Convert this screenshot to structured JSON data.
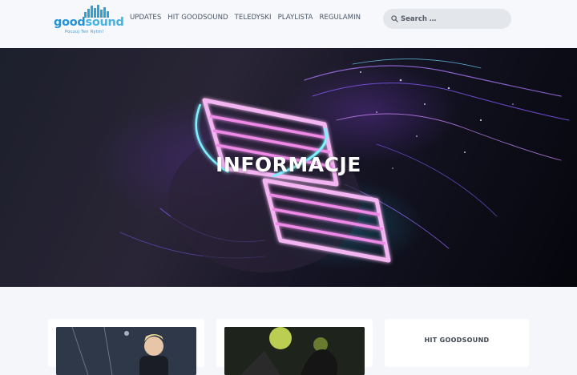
{
  "brand": {
    "name_part1": "good",
    "name_part2": "sound",
    "tagline": "Poczuj Ten Rytm!",
    "primary_color": "#1f95d8",
    "secondary_color": "#41b3e4"
  },
  "nav": {
    "items": [
      {
        "label": "UPDATES"
      },
      {
        "label": "HIT GOODSOUND"
      },
      {
        "label": "TELEDYSKI"
      },
      {
        "label": "PLAYLISTA"
      },
      {
        "label": "REGULAMIN"
      }
    ]
  },
  "search": {
    "placeholder": "Search …",
    "icon": "search-icon"
  },
  "hero": {
    "title": "INFORMACJE"
  },
  "sidebar": {
    "widget_title": "HIT GOODSOUND"
  }
}
